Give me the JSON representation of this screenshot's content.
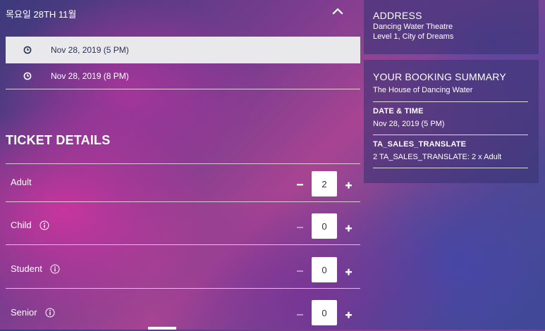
{
  "date_header": {
    "title": "목요일 28TH 11월"
  },
  "showtimes": [
    {
      "label": "Nov 28, 2019 (5 PM)",
      "selected": true
    },
    {
      "label": "Nov 28, 2019 (8 PM)",
      "selected": false
    }
  ],
  "ticket_details": {
    "title": "TICKET DETAILS",
    "rows": [
      {
        "label": "Adult",
        "qty": "2",
        "has_info": false
      },
      {
        "label": "Child",
        "qty": "0",
        "has_info": true
      },
      {
        "label": "Student",
        "qty": "0",
        "has_info": true
      },
      {
        "label": "Senior",
        "qty": "0",
        "has_info": true
      }
    ]
  },
  "address": {
    "title": "ADDRESS",
    "venue": "Dancing Water Theatre",
    "location": "Level 1, City of Dreams"
  },
  "summary": {
    "title": "YOUR BOOKING SUMMARY",
    "show": "The House of Dancing Water",
    "date_time_title": "DATE & TIME",
    "date_time_value": "Nov 28, 2019 (5 PM)",
    "sales_title": "TA_SALES_TRANSLATE",
    "sales_value": "2 TA_SALES_TRANSLATE: 2 x Adult"
  },
  "icons": {
    "chevron": "chevron-up-icon",
    "clock": "clock-icon",
    "info": "info-icon",
    "minus": "minus-icon",
    "plus": "plus-icon"
  },
  "colors": {
    "selected_row_bg": "#e9e9eb",
    "selected_row_text": "#2b2f5a",
    "panel_bg": "#3a3476"
  }
}
